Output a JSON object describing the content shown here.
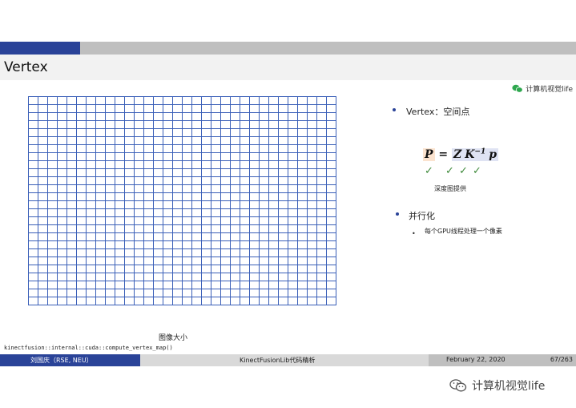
{
  "slide": {
    "title": "Vertex",
    "watermark_small": "计算机视觉life",
    "grid_caption": "图像大小",
    "function_name": "kinectfusion::internal::cuda::compute_vertex_map()"
  },
  "bullets": [
    {
      "text": "Vertex：空间点"
    },
    {
      "text": "并行化",
      "sub": [
        "每个GPU线程处理一个像素"
      ]
    }
  ],
  "formula": {
    "lhs": "P",
    "eq": " = ",
    "z": "Z",
    "k": "K",
    "k_exp": "−1",
    "p": "p",
    "checks": [
      "✓",
      "✓",
      "✓",
      "✓"
    ],
    "caption": "深度图提供"
  },
  "footer": {
    "author": "刘国庆（RSE, NEU）",
    "talk_title": "KinectFusionLib代码精析",
    "date": "February 22, 2020",
    "page": "67/263"
  },
  "watermark_big": "计算机视觉life",
  "colors": {
    "accent": "#2a4398",
    "grid": "#3a5fb8",
    "check": "#3f8a3b"
  }
}
